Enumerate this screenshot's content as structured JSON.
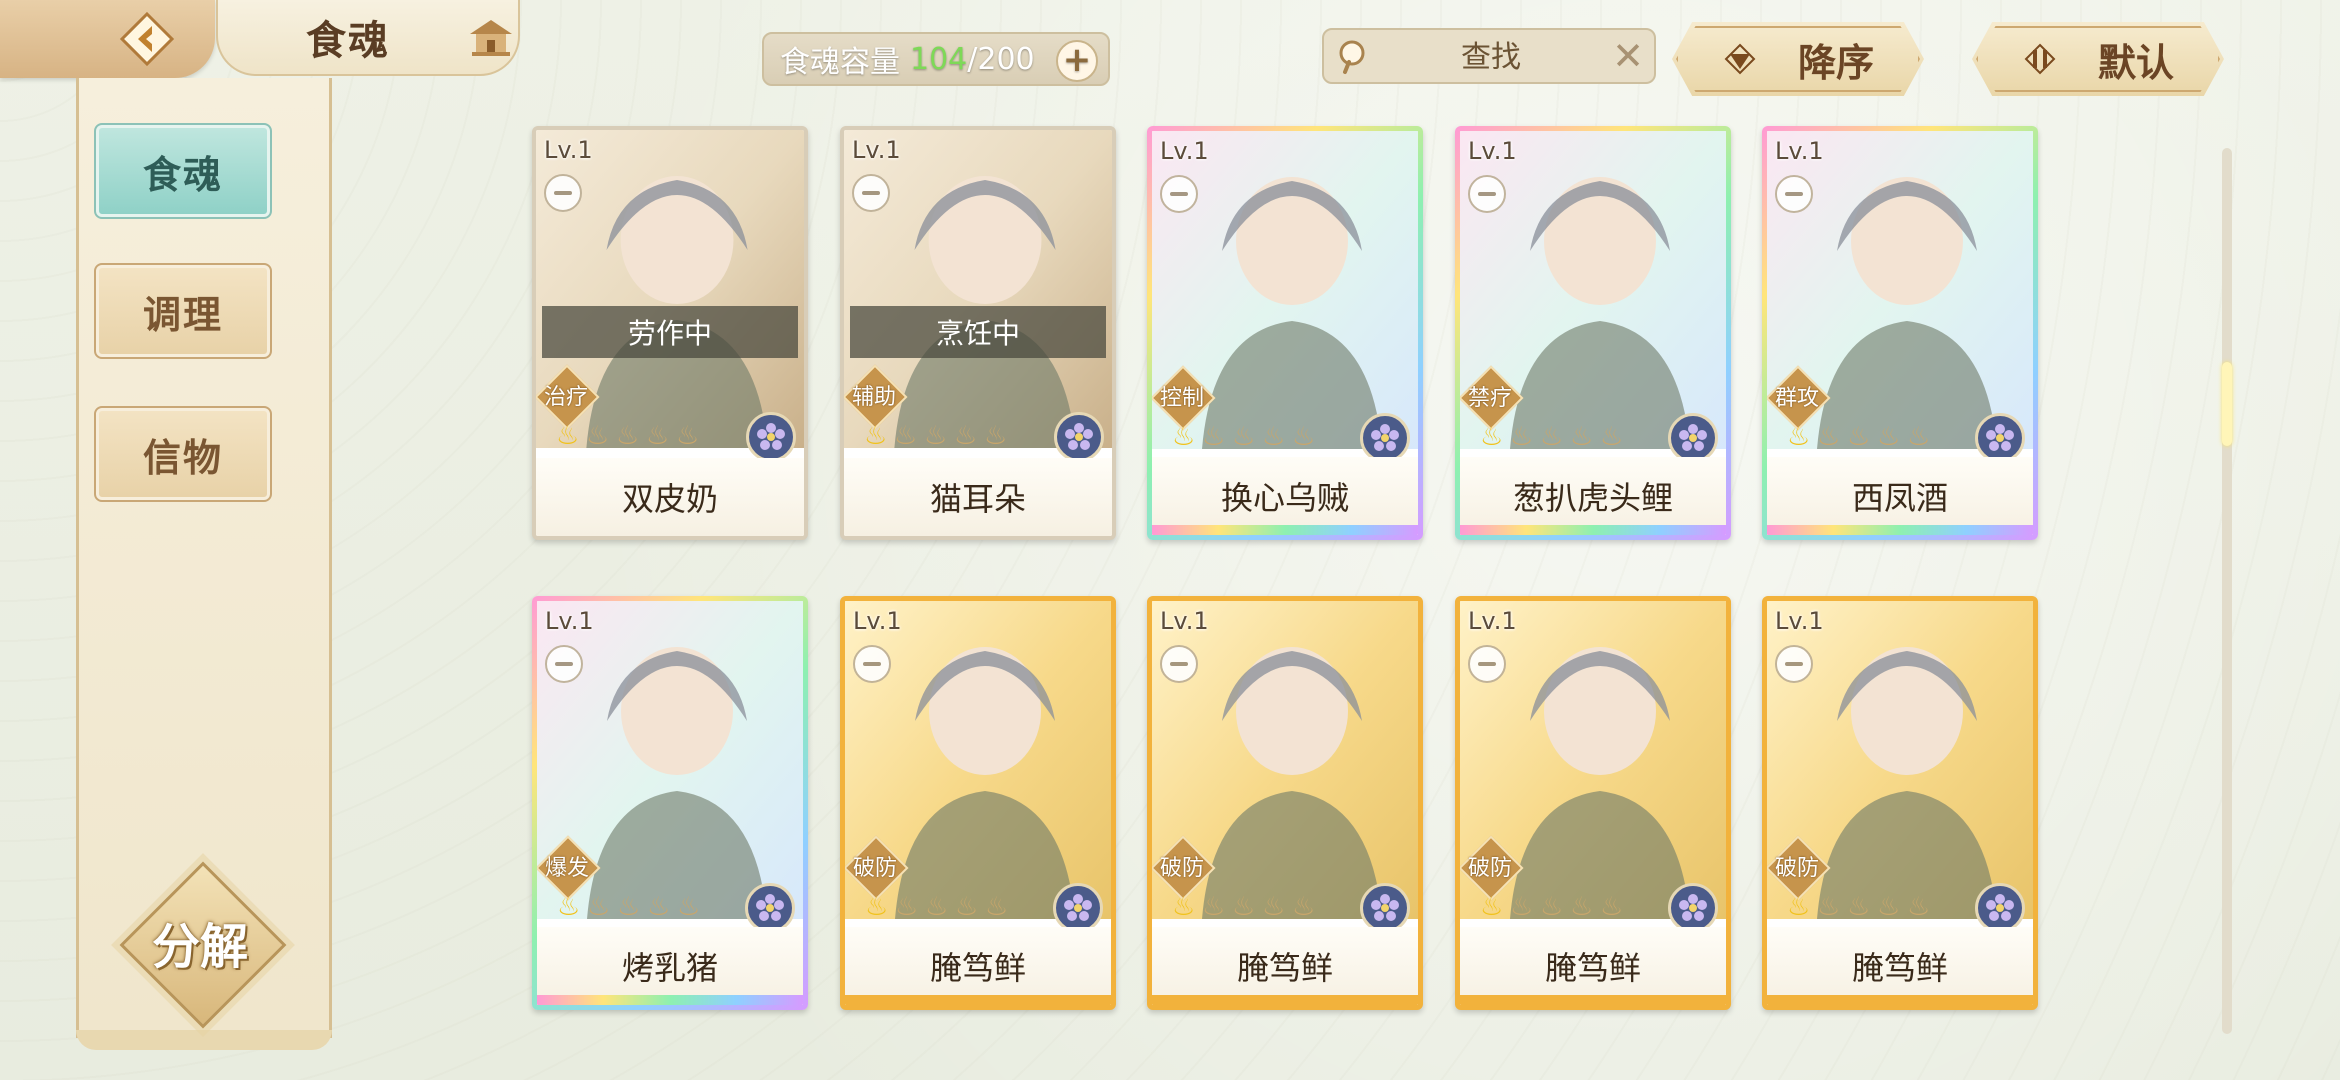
{
  "header": {
    "title": "食魂",
    "capacity_label": "食魂容量",
    "capacity_current": "104",
    "capacity_max": "/200",
    "search_placeholder": "查找",
    "sort_desc_label": "降序",
    "sort_default_label": "默认"
  },
  "sidebar": {
    "tabs": [
      {
        "label": "食魂",
        "active": true
      },
      {
        "label": "调理",
        "active": false
      },
      {
        "label": "信物",
        "active": false
      }
    ],
    "decompose_label": "分解"
  },
  "cards": [
    {
      "level": "Lv.1",
      "name": "双皮奶",
      "role": "治疗",
      "status": "劳作中",
      "rarity": "plain",
      "stars": 1
    },
    {
      "level": "Lv.1",
      "name": "猫耳朵",
      "role": "辅助",
      "status": "烹饪中",
      "rarity": "plain",
      "stars": 1
    },
    {
      "level": "Lv.1",
      "name": "换心乌贼",
      "role": "控制",
      "status": "",
      "rarity": "rainbow",
      "stars": 1
    },
    {
      "level": "Lv.1",
      "name": "葱扒虎头鲤",
      "role": "禁疗",
      "status": "",
      "rarity": "rainbow",
      "stars": 1
    },
    {
      "level": "Lv.1",
      "name": "西凤酒",
      "role": "群攻",
      "status": "",
      "rarity": "rainbow",
      "stars": 1
    },
    {
      "level": "Lv.1",
      "name": "烤乳猪",
      "role": "爆发",
      "status": "",
      "rarity": "rainbow",
      "stars": 1
    },
    {
      "level": "Lv.1",
      "name": "腌笃鲜",
      "role": "破防",
      "status": "",
      "rarity": "gold",
      "stars": 1
    },
    {
      "level": "Lv.1",
      "name": "腌笃鲜",
      "role": "破防",
      "status": "",
      "rarity": "gold",
      "stars": 1
    },
    {
      "level": "Lv.1",
      "name": "腌笃鲜",
      "role": "破防",
      "status": "",
      "rarity": "gold",
      "stars": 1
    },
    {
      "level": "Lv.1",
      "name": "腌笃鲜",
      "role": "破防",
      "status": "",
      "rarity": "gold",
      "stars": 1
    }
  ],
  "icons": {
    "back": "back-arrow-icon",
    "home": "house-icon",
    "search": "magnifier-icon",
    "clear": "close-icon",
    "sort_desc": "triangle-down-icon",
    "sort_default": "sort-arrows-icon",
    "element": "flower-element-icon",
    "bowl": "bowl-icon",
    "star": "flame-star-icon"
  },
  "colors": {
    "accent_teal": "#8fd1c7",
    "gold": "#f2b23c",
    "capacity_current": "#7ed957"
  }
}
